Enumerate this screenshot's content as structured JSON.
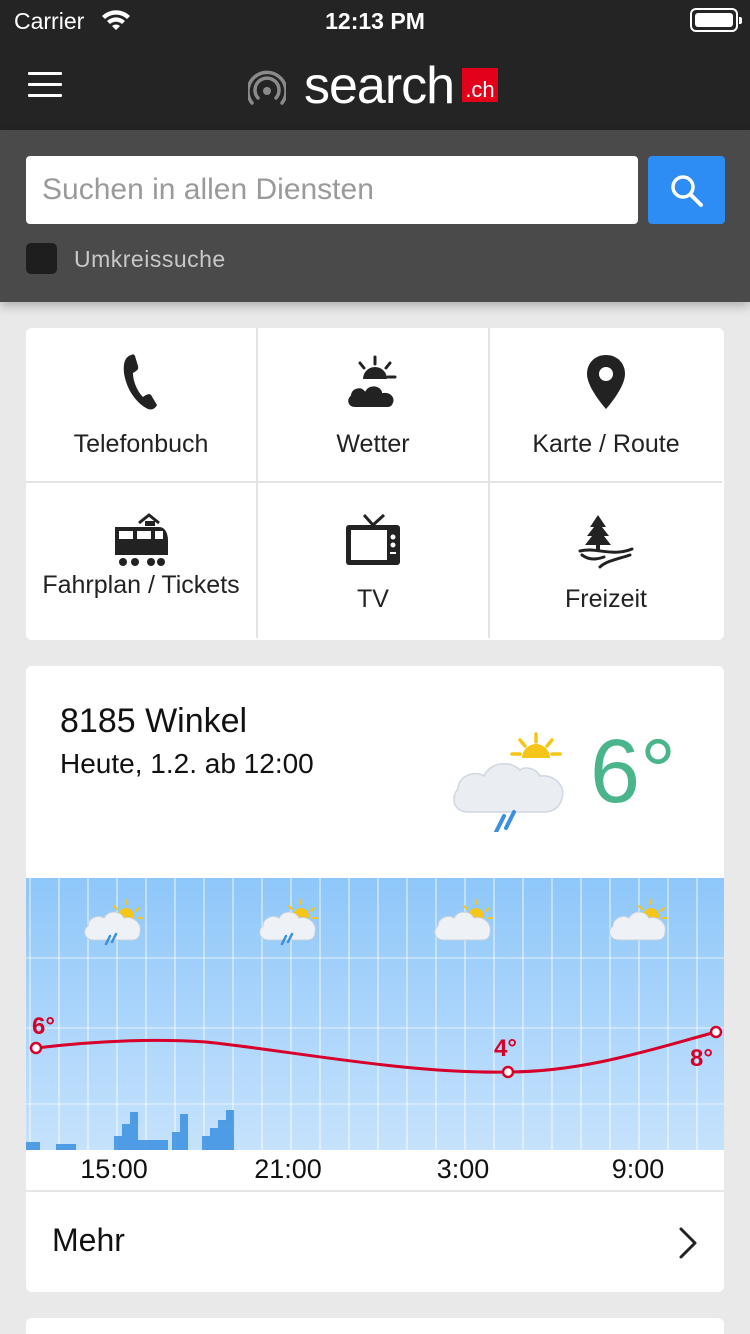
{
  "status": {
    "carrier": "Carrier",
    "time": "12:13 PM"
  },
  "header": {
    "brand_word": "search",
    "brand_suffix": ".ch"
  },
  "search": {
    "placeholder": "Suchen in allen Diensten",
    "value": "",
    "radius_label": "Umkreissuche",
    "radius_checked": false
  },
  "services": [
    {
      "label": "Telefonbuch",
      "icon": "phone-icon"
    },
    {
      "label": "Wetter",
      "icon": "weather-icon"
    },
    {
      "label": "Karte / Route",
      "icon": "map-pin-icon"
    },
    {
      "label": "Fahrplan / Tickets",
      "icon": "train-icon"
    },
    {
      "label": "TV",
      "icon": "tv-icon"
    },
    {
      "label": "Freizeit",
      "icon": "leisure-icon"
    }
  ],
  "weather": {
    "location": "8185 Winkel",
    "date": "Heute, 1.2. ab 12:00",
    "temperature": "6°",
    "condition_icon": "partly-cloudy-rain-icon",
    "temp_labels": [
      "6°",
      "4°",
      "8°"
    ],
    "time_labels": [
      "15:00",
      "21:00",
      "3:00",
      "9:00"
    ],
    "forecast_icons": [
      "partly-cloudy-rain-icon",
      "partly-cloudy-rain-icon",
      "partly-cloudy-icon",
      "partly-cloudy-icon"
    ],
    "more_label": "Mehr",
    "colors": {
      "temp_line": "#d6002a",
      "chart_bg": "#a8d4fb",
      "rain": "#3a8fe0",
      "temp_text": "#4ab58a"
    }
  }
}
